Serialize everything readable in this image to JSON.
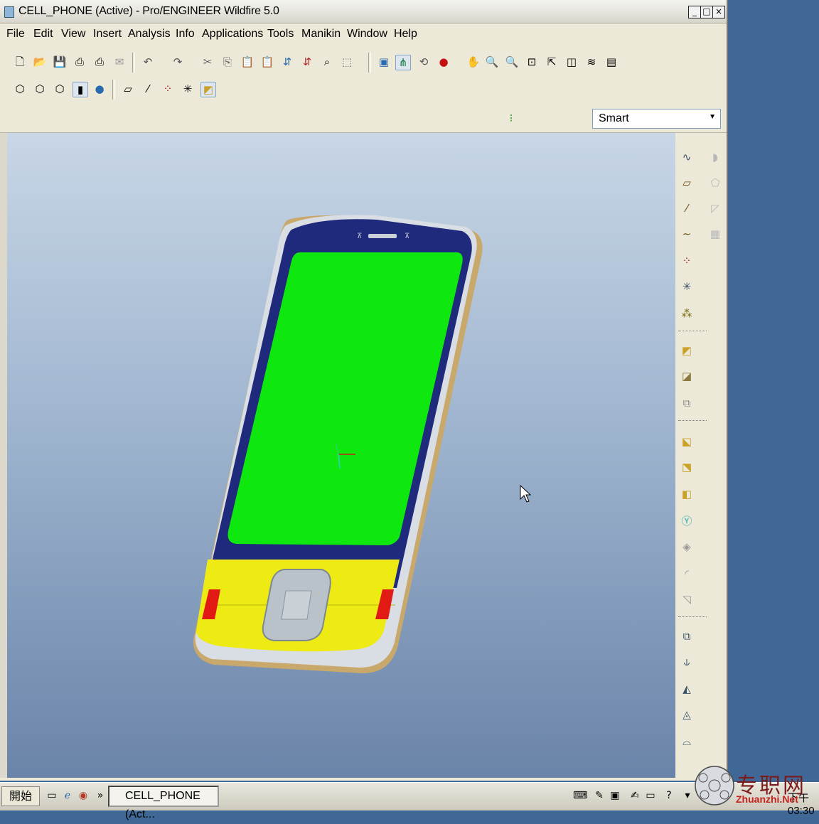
{
  "window": {
    "title": "CELL_PHONE (Active) - Pro/ENGINEER Wildfire 5.0",
    "minimize": "_",
    "maximize": "□",
    "close": "×"
  },
  "menu": [
    "File",
    "Edit",
    "View",
    "Insert",
    "Analysis",
    "Info",
    "Applications",
    "Tools",
    "Manikin",
    "Window",
    "Help"
  ],
  "toolbar": {
    "row1_icons": [
      "new-file",
      "open-file",
      "save",
      "print",
      "print-preview",
      "email",
      "undo",
      "redo",
      "cut",
      "copy",
      "paste",
      "paste-special",
      "regenerate",
      "regenerate-manager",
      "find",
      "select-box",
      "repaint",
      "spin-center",
      "orient",
      "appearance",
      "pan",
      "zoom-in",
      "zoom-out",
      "refit",
      "view-manager",
      "saved-views",
      "layers",
      "model-tree"
    ],
    "row2_icons": [
      "wireframe",
      "hidden-line",
      "no-hidden",
      "shaded",
      "enhanced-realism",
      "datum-planes",
      "datum-axes",
      "datum-points",
      "coordinate-systems",
      "annotations"
    ]
  },
  "filter": {
    "selected": "Smart"
  },
  "right_panel_icons": [
    "sketch-datum-curve",
    "datum-plane",
    "datum-axis",
    "datum-curve",
    "datum-point",
    "datum-coordinate-system",
    "analysis-feature",
    "annotation-feature",
    "note",
    "copy-geometry",
    "extrude",
    "revolve",
    "variable-section-sweep",
    "boundary-blend",
    "hole",
    "round",
    "chamfer",
    "draft",
    "pattern",
    "mirror",
    "merge",
    "trim",
    "offset"
  ],
  "taskbar": {
    "start_label": "開始",
    "task_label": "CELL_PHONE (Act...",
    "clock": "下午 03:30"
  },
  "watermark": {
    "text": "专职网",
    "sub": "Zhuanzhi.Net"
  },
  "colors": {
    "screen": "#0ee80e",
    "body": "#1f2a7c",
    "keypad": "#eeea14",
    "side_buttons": "#e21a14",
    "nav_button": "#b9c2c9"
  }
}
